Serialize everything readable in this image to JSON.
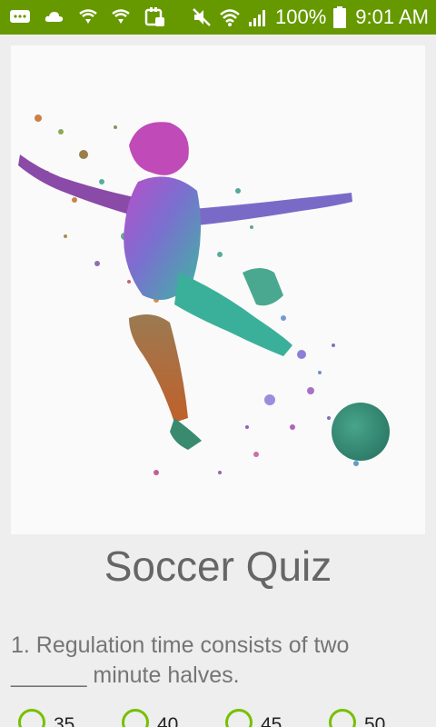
{
  "status_bar": {
    "battery": "100%",
    "time": "9:01 AM",
    "background_color": "#669900",
    "left_icons": [
      "chat-notification-icon",
      "cloud-icon",
      "shield-icon",
      "shield-icon",
      "app-notification-icon"
    ],
    "right_icons": [
      "mute-icon",
      "wifi-icon",
      "signal-icon",
      "battery-icon"
    ]
  },
  "hero": {
    "image": "watercolor-soccer-player-illustration"
  },
  "quiz": {
    "title": "Soccer Quiz",
    "question": "1. Regulation time consists of two ______ minute halves.",
    "options": [
      "35",
      "40",
      "45",
      "50"
    ],
    "accent_color": "#76c000"
  }
}
